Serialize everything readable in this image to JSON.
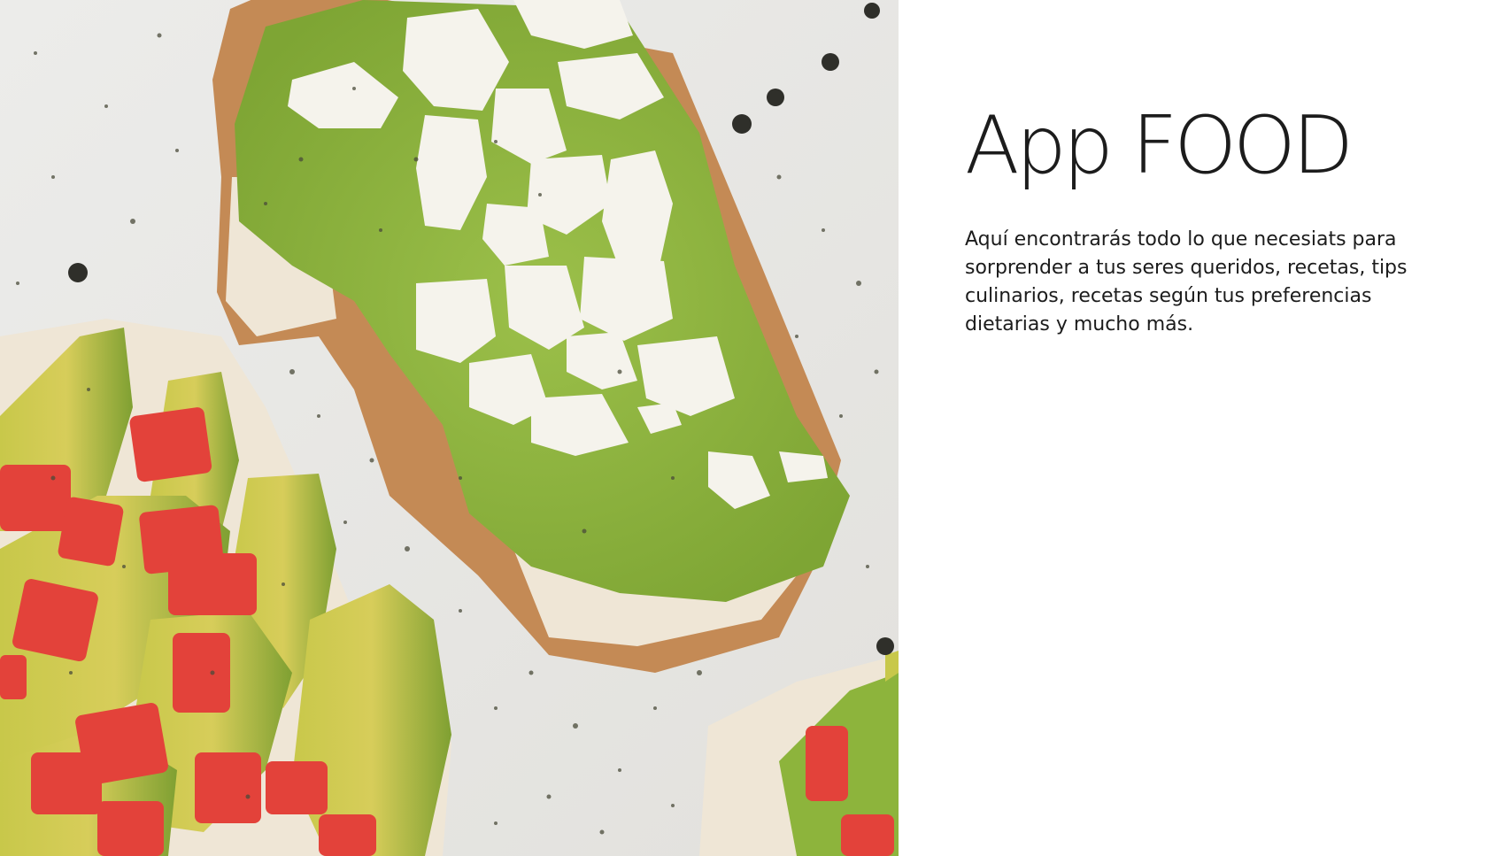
{
  "page": {
    "title": "App FOOD",
    "description": "Aquí encontrarás todo lo que necesiats para sorprender a tus seres queridos, recetas, tips culinarios, recetas según tus preferencias dietarias y mucho más."
  },
  "hero_image": {
    "subject": "avocado-toast",
    "colors": {
      "background": "#e9e8e4",
      "avocado": "#8db43c",
      "bread_crust": "#c48a55",
      "bread_crumb": "#f1eadf",
      "cheese": "#f5f3ec",
      "tomato": "#e3423a",
      "pepper": "#3d4030"
    }
  }
}
